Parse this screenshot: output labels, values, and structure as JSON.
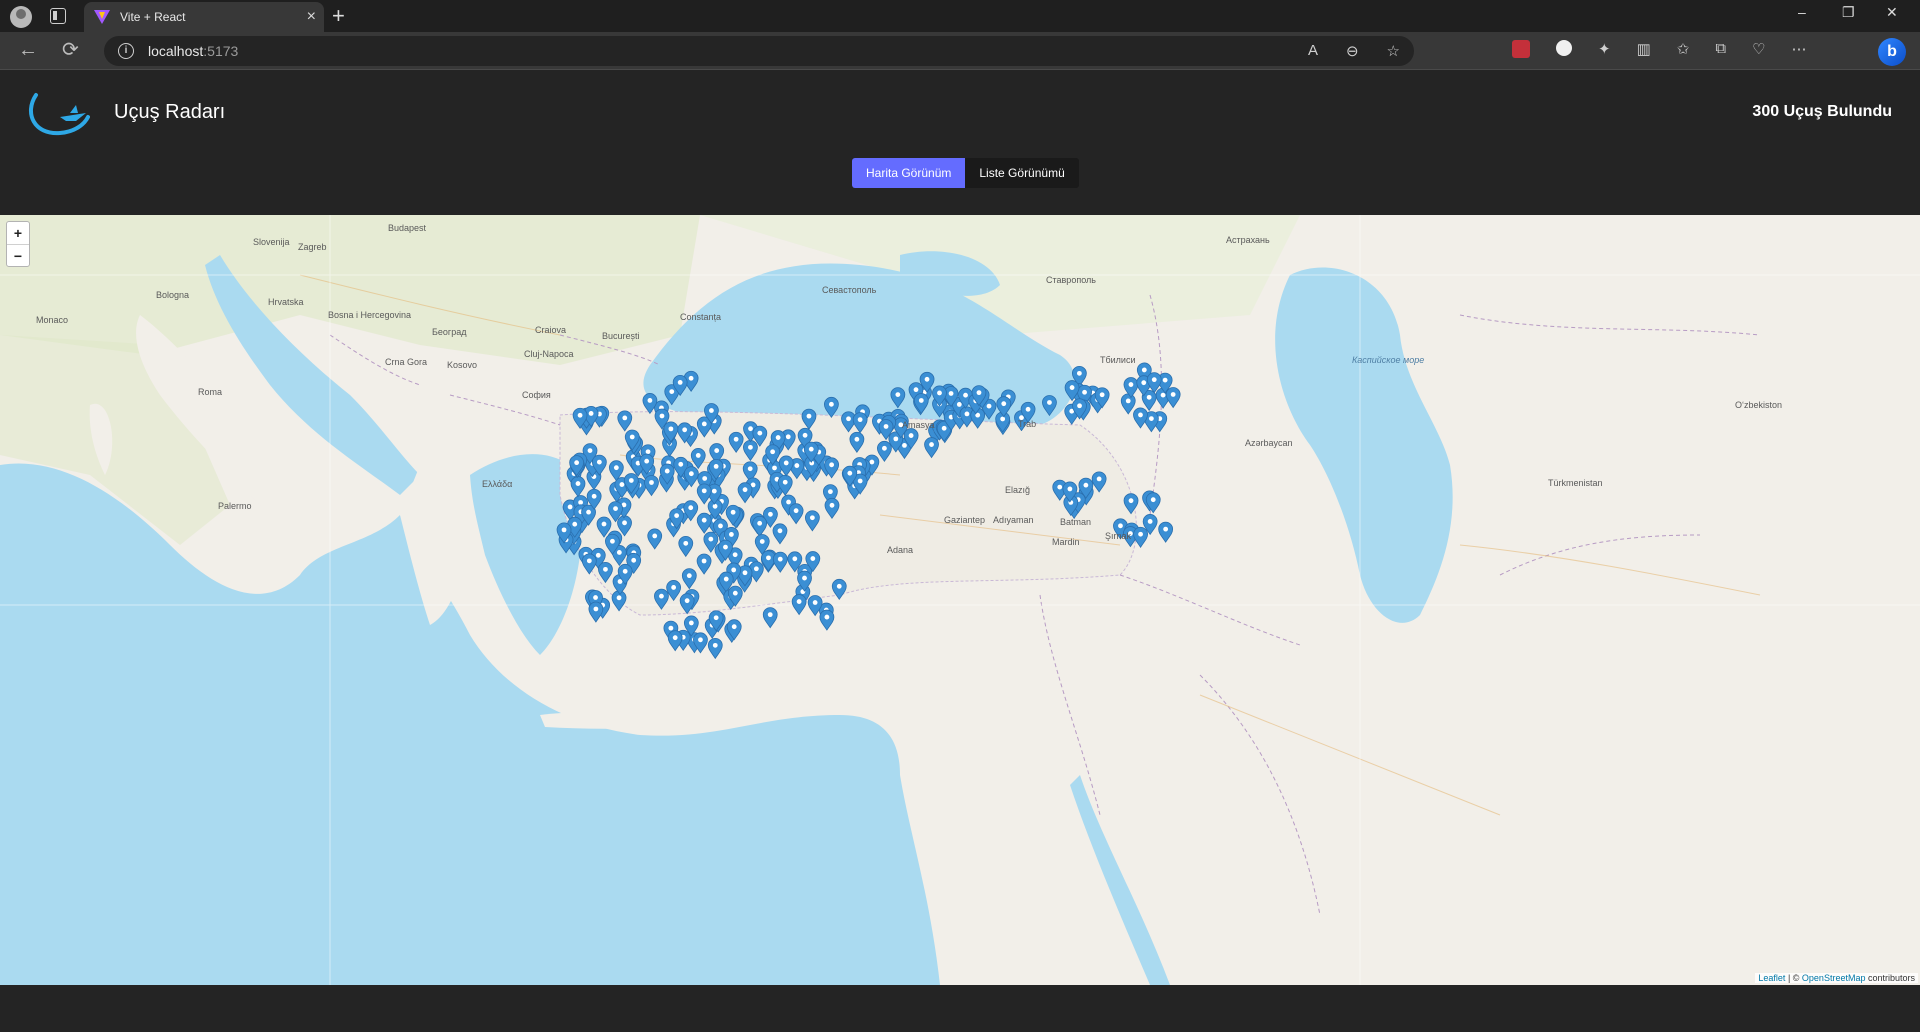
{
  "browser": {
    "tab_title": "Vite + React",
    "tab_close": "×",
    "new_tab": "+",
    "url_host": "localhost",
    "url_port": ":5173",
    "window_controls": [
      "–",
      "❐",
      "✕"
    ]
  },
  "header": {
    "title": "Uçuş Radarı",
    "flight_count": "300 Uçuş Bulundu"
  },
  "view_toggle": {
    "map_label": "Harita Görünüm",
    "list_label": "Liste Görünümü",
    "active": "map"
  },
  "map": {
    "zoom_in": "+",
    "zoom_out": "−",
    "attribution_leaflet": "Leaflet",
    "attribution_sep": " | © ",
    "attribution_osm": "OpenStreetMap",
    "attribution_tail": " contributors",
    "marker_color": "#3b8fd4",
    "sea_color": "#aadaf0",
    "land_color": "#f2efe9",
    "labels": {
      "budapest": "Budapest",
      "beograd": "Београд",
      "bucuresti": "București",
      "sofia": "София",
      "constanta": "Constanța",
      "sevastopol": "Севастополь",
      "stavropol": "Ставрополь",
      "astrakhan": "Астрахань",
      "azerbaycan": "Azərbaycan",
      "turkmenistan": "Türkmenistan",
      "oezbekiston": "Oʻzbekiston",
      "roma": "Roma",
      "palermo": "Palermo",
      "adana": "Adana",
      "gaziantep": "Gaziantep",
      "ellada": "Ελλάδα",
      "cluj": "Cluj-Napoca",
      "craiova": "Craiova",
      "crna_gora": "Crna Gora",
      "kosovo": "Kosovo",
      "bosna": "Bosna i Hercegovina",
      "hrvatska": "Hrvatska",
      "slovenija": "Slovenija",
      "zagreb": "Zagreb",
      "bologna": "Bologna",
      "monaco": "Monaco",
      "kaspiy": "Каспийское море",
      "tbilisi": "Тбилиси",
      "mardin": "Mardin",
      "batman": "Batman",
      "elazig": "Elazığ",
      "adiyaman": "Adıyaman",
      "trabzon": "Trab",
      "amasya": "Amasya",
      "sirnak": "Şırnak"
    }
  }
}
